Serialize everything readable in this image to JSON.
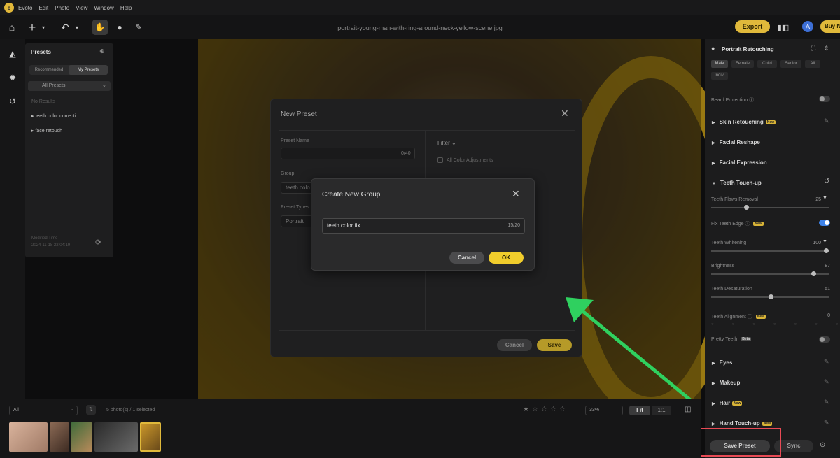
{
  "menubar": {
    "app": "Evoto",
    "items": [
      "Edit",
      "Photo",
      "View",
      "Window",
      "Help"
    ]
  },
  "toolbar": {
    "filename": "portrait-young-man-with-ring-around-neck-yellow-scene.jpg",
    "export_label": "Export",
    "avatar_initial": "A",
    "buy_label": "Buy N"
  },
  "presets_panel": {
    "title": "Presets",
    "tab_recommended": "Recommended",
    "tab_my": "My Presets",
    "filter": "All Presets",
    "no_results": "No Results",
    "items": [
      "teeth color correcti",
      "face retouch"
    ],
    "footer_label": "Modified Time",
    "footer_date": "2024-11-18 22:04:19"
  },
  "new_preset_dialog": {
    "title": "New Preset",
    "name_label": "Preset Name",
    "name_count": "0/40",
    "group_label": "Group",
    "group_value": "teeth colo",
    "type_label": "Preset Types",
    "type_value": "Portrait",
    "filter_label": "Filter",
    "opt1": "All Color Adjustments",
    "cancel": "Cancel",
    "save": "Save"
  },
  "create_group_dialog": {
    "title": "Create New Group",
    "input_value": "teeth color fix",
    "count": "15/20",
    "cancel": "Cancel",
    "ok": "OK"
  },
  "right_panel": {
    "title": "Portrait Retouching",
    "chips": [
      "Male",
      "Female",
      "Child",
      "Senior",
      "All",
      "Indiv."
    ],
    "beard": "Beard Protection",
    "sections": {
      "skin": "Skin Retouching",
      "reshape": "Facial Reshape",
      "expression": "Facial Expression",
      "teeth": "Teeth Touch-up",
      "eyes": "Eyes",
      "makeup": "Makeup",
      "hair": "Hair",
      "hand": "Hand Touch-up"
    },
    "new_badge": "New",
    "beta_badge": "Beta",
    "sliders": [
      {
        "label": "Teeth Flaws Removal",
        "value": "25",
        "pct": 0.3
      },
      {
        "label": "Teeth Whitening",
        "value": "100",
        "pct": 1.0
      },
      {
        "label": "Brightness",
        "value": "87",
        "pct": 0.87
      },
      {
        "label": "Teeth Desaturation",
        "value": "51",
        "pct": 0.51
      }
    ],
    "fix_edge": "Fix Teeth Edge",
    "alignment": "Teeth Alignment",
    "alignment_value": "0",
    "pretty": "Pretty Teeth",
    "save_preset": "Save Preset",
    "sync": "Sync"
  },
  "bottom": {
    "filter": "All",
    "count_text": "5 photo(s) / 1 selected",
    "zoom": "33%",
    "fit": "Fit",
    "one_to_one": "1:1"
  },
  "colors": {
    "accent": "#e0b93b",
    "ok": "#f1cd2c",
    "highlight": "#e84a55",
    "arrow": "#2fd05f"
  }
}
